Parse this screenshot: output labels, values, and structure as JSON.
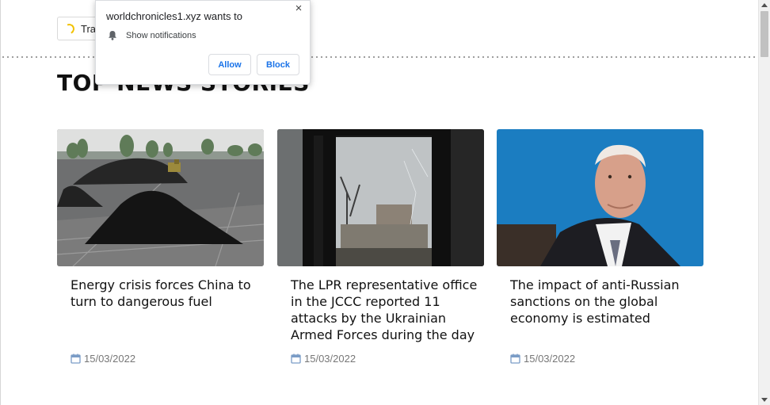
{
  "language_chip": {
    "label": "Tra"
  },
  "section": {
    "title": "TOP NEWS STORIES"
  },
  "articles": [
    {
      "title": "Energy crisis forces China to turn to dangerous fuel",
      "date": "15/03/2022",
      "image_icon": "coal-piles-photo"
    },
    {
      "title": "The LPR representative office in the JCCC reported 11 attacks by the Ukrainian Armed Forces during the day",
      "date": "15/03/2022",
      "image_icon": "broken-window-photo"
    },
    {
      "title": "The impact of anti-Russian sanctions on the global economy is estimated",
      "date": "15/03/2022",
      "image_icon": "portrait-photo"
    }
  ],
  "notification_prompt": {
    "site": "worldchronicles1.xyz wants to",
    "permission": "Show notifications",
    "allow_label": "Allow",
    "block_label": "Block",
    "close_glyph": "×"
  },
  "colors": {
    "link_blue": "#1a73e8",
    "date_gray": "#777777",
    "spinner_yellow": "#f2c200"
  }
}
